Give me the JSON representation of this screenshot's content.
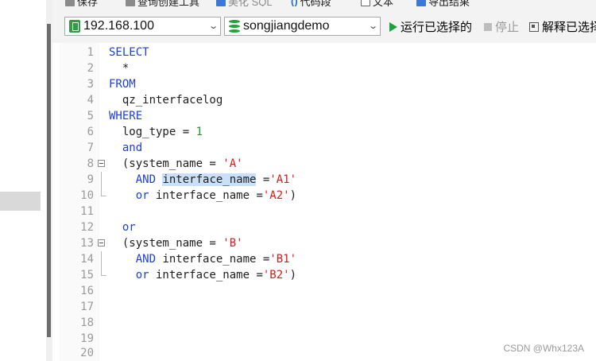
{
  "toolbar": {
    "save_label": "保存",
    "query_builder_label": "查询创建工具",
    "beautify_label": "美化 SQL",
    "snippet_label": "代码段",
    "text_label": "文本",
    "export_label": "导出结果"
  },
  "connection": {
    "value": "192.168.100"
  },
  "database": {
    "value": "songjiangdemo"
  },
  "actions": {
    "run_selected_label": "运行已选择的",
    "stop_label": "停止",
    "explain_label": "解释已选择"
  },
  "editor": {
    "lines": [
      {
        "num": "1"
      },
      {
        "num": "2"
      },
      {
        "num": "3"
      },
      {
        "num": "4"
      },
      {
        "num": "5"
      },
      {
        "num": "6"
      },
      {
        "num": "7"
      },
      {
        "num": "8"
      },
      {
        "num": "9"
      },
      {
        "num": "10"
      },
      {
        "num": "11"
      },
      {
        "num": "12"
      },
      {
        "num": "13"
      },
      {
        "num": "14"
      },
      {
        "num": "15"
      },
      {
        "num": "16"
      },
      {
        "num": "17"
      },
      {
        "num": "18"
      },
      {
        "num": "19"
      },
      {
        "num": "20"
      }
    ],
    "tokens": {
      "select": "SELECT",
      "star": "*",
      "from": "FROM",
      "table": "qz_interfacelog",
      "where": "WHERE",
      "log_type": "log_type = ",
      "one": "1",
      "and": "and",
      "sys_open": "(system_name = ",
      "str_a": "'A'",
      "and_upper": "AND",
      "iface_hl": "interface_name",
      "eq": " =",
      "str_a1": "'A1'",
      "or_lower": "or",
      "iface": " interface_name =",
      "str_a2": "'A2'",
      "close": ")",
      "str_b": "'B'",
      "str_b1": "'B1'",
      "str_b2": "'B2'"
    }
  },
  "watermark": "CSDN @Whx123A"
}
